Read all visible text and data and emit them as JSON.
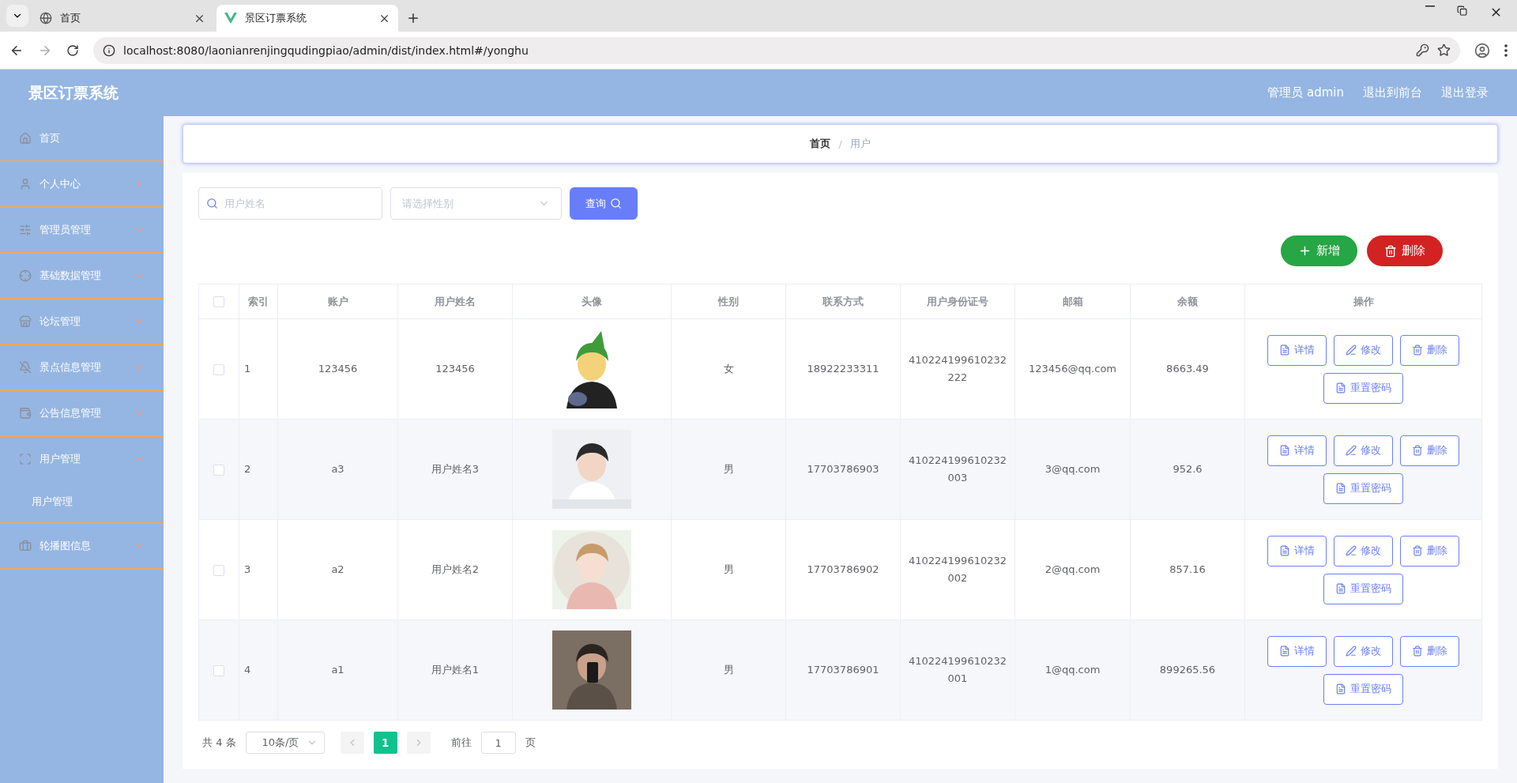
{
  "browser": {
    "tabs": [
      {
        "title": "首页",
        "selected": false
      },
      {
        "title": "景区订票系统",
        "selected": true
      }
    ],
    "url": "localhost:8080/laonianrenjingqudingpiao/admin/dist/index.html#/yonghu"
  },
  "header": {
    "title": "景区订票系统",
    "links": [
      "管理员 admin",
      "退出到前台",
      "退出登录"
    ]
  },
  "sidebar": {
    "items": [
      {
        "label": "首页",
        "kind": "link"
      },
      {
        "label": "个人中心",
        "kind": "submenu",
        "expanded": false
      },
      {
        "label": "管理员管理",
        "kind": "submenu",
        "expanded": false
      },
      {
        "label": "基础数据管理",
        "kind": "submenu",
        "expanded": false
      },
      {
        "label": "论坛管理",
        "kind": "submenu",
        "expanded": false
      },
      {
        "label": "景点信息管理",
        "kind": "submenu",
        "expanded": false
      },
      {
        "label": "公告信息管理",
        "kind": "submenu",
        "expanded": false
      },
      {
        "label": "用户管理",
        "kind": "submenu",
        "expanded": true,
        "children": [
          {
            "label": "用户管理"
          }
        ]
      },
      {
        "label": "轮播图信息",
        "kind": "submenu",
        "expanded": false
      }
    ]
  },
  "breadcrumb": [
    "首页",
    "用户"
  ],
  "breadcrumb_separator": "/",
  "search": {
    "name_placeholder": "用户姓名",
    "gender_placeholder": "请选择性别",
    "query_button": "查询"
  },
  "toolbar": {
    "add_button": "新增",
    "delete_button": "删除"
  },
  "table": {
    "header_checked": false,
    "columns": [
      "索引",
      "账户",
      "用户姓名",
      "头像",
      "性别",
      "联系方式",
      "用户身份证号",
      "邮箱",
      "余额",
      "操作"
    ],
    "rows": [
      {
        "checked": false,
        "index": "1",
        "account": "123456",
        "name": "123456",
        "gender": "女",
        "phone": "18922233311",
        "id_number": "410224199610232222",
        "email": "123456@qq.com",
        "balance": "8663.49",
        "actions": [
          {
            "kind": "detail",
            "label": "详情"
          },
          {
            "kind": "edit",
            "label": "修改"
          },
          {
            "kind": "delete",
            "label": "删除"
          },
          {
            "kind": "reset",
            "label": "重置密码"
          }
        ]
      },
      {
        "checked": false,
        "index": "2",
        "account": "a3",
        "name": "用户姓名3",
        "gender": "男",
        "phone": "17703786903",
        "id_number": "410224199610232003",
        "email": "3@qq.com",
        "balance": "952.6",
        "actions": [
          {
            "kind": "detail",
            "label": "详情"
          },
          {
            "kind": "edit",
            "label": "修改"
          },
          {
            "kind": "delete",
            "label": "删除"
          },
          {
            "kind": "reset",
            "label": "重置密码"
          }
        ]
      },
      {
        "checked": false,
        "index": "3",
        "account": "a2",
        "name": "用户姓名2",
        "gender": "男",
        "phone": "17703786902",
        "id_number": "410224199610232002",
        "email": "2@qq.com",
        "balance": "857.16",
        "actions": [
          {
            "kind": "detail",
            "label": "详情"
          },
          {
            "kind": "edit",
            "label": "修改"
          },
          {
            "kind": "delete",
            "label": "删除"
          },
          {
            "kind": "reset",
            "label": "重置密码"
          }
        ]
      },
      {
        "checked": false,
        "index": "4",
        "account": "a1",
        "name": "用户姓名1",
        "gender": "男",
        "phone": "17703786901",
        "id_number": "410224199610232001",
        "email": "1@qq.com",
        "balance": "899265.56",
        "actions": [
          {
            "kind": "detail",
            "label": "详情"
          },
          {
            "kind": "edit",
            "label": "修改"
          },
          {
            "kind": "delete",
            "label": "删除"
          },
          {
            "kind": "reset",
            "label": "重置密码"
          }
        ]
      }
    ]
  },
  "pagination": {
    "total": "共 4 条",
    "page_size": "10条/页",
    "pages": [
      {
        "label": "1",
        "selected": true
      }
    ],
    "goto_label": "前往",
    "goto_value": "1",
    "goto_suffix": "页"
  }
}
